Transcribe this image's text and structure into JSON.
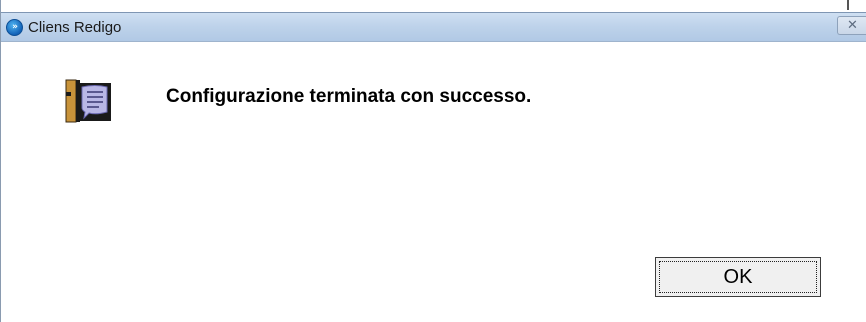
{
  "window": {
    "title": "Cliens Redigo",
    "close_glyph": "✕"
  },
  "app_icon": {
    "name": "cliens-redigo-app-icon",
    "glyph": "»"
  },
  "dialog": {
    "icon": "info-speech-icon",
    "message": "Configurazione terminata con successo.",
    "ok_label": "OK"
  }
}
